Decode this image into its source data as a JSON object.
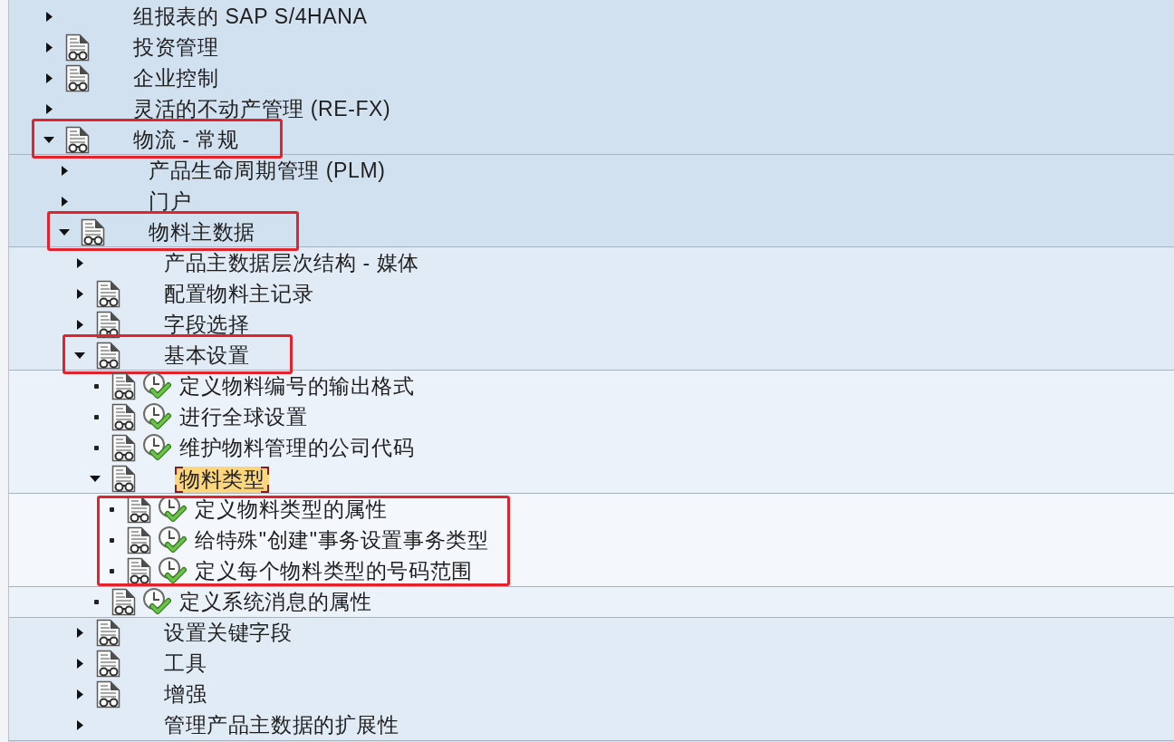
{
  "tree": [
    {
      "label": "组报表的 SAP S/4HANA",
      "kind": "folder",
      "expanded": false,
      "doc_icon": false,
      "selected": false,
      "marked": false
    },
    {
      "label": "投资管理",
      "kind": "folder",
      "expanded": false,
      "doc_icon": true,
      "selected": false,
      "marked": false
    },
    {
      "label": "企业控制",
      "kind": "folder",
      "expanded": false,
      "doc_icon": true,
      "selected": false,
      "marked": false
    },
    {
      "label": "灵活的不动产管理 (RE-FX)",
      "kind": "folder",
      "expanded": false,
      "doc_icon": false,
      "selected": false,
      "marked": false
    },
    {
      "label": "物流 - 常规",
      "kind": "folder",
      "expanded": true,
      "doc_icon": true,
      "selected": false,
      "marked": true,
      "children_marked": false,
      "children": [
        {
          "label": "产品生命周期管理 (PLM)",
          "kind": "folder",
          "expanded": false,
          "doc_icon": false,
          "selected": false,
          "marked": false
        },
        {
          "label": "门户",
          "kind": "folder",
          "expanded": false,
          "doc_icon": false,
          "selected": false,
          "marked": false
        },
        {
          "label": "物料主数据",
          "kind": "folder",
          "expanded": true,
          "doc_icon": true,
          "selected": false,
          "marked": true,
          "children_marked": false,
          "children": [
            {
              "label": "产品主数据层次结构 - 媒体",
              "kind": "folder",
              "expanded": false,
              "doc_icon": false,
              "selected": false,
              "marked": false
            },
            {
              "label": "配置物料主记录",
              "kind": "folder",
              "expanded": false,
              "doc_icon": true,
              "selected": false,
              "marked": false
            },
            {
              "label": "字段选择",
              "kind": "folder",
              "expanded": false,
              "doc_icon": true,
              "selected": false,
              "marked": false
            },
            {
              "label": "基本设置",
              "kind": "folder",
              "expanded": true,
              "doc_icon": true,
              "selected": false,
              "marked": true,
              "children_marked": false,
              "children": [
                {
                  "label": "定义物料编号的输出格式",
                  "kind": "activity",
                  "doc_icon": true,
                  "selected": false,
                  "marked": false
                },
                {
                  "label": "进行全球设置",
                  "kind": "activity",
                  "doc_icon": true,
                  "selected": false,
                  "marked": false
                },
                {
                  "label": "维护物料管理的公司代码",
                  "kind": "activity",
                  "doc_icon": true,
                  "selected": false,
                  "marked": false
                },
                {
                  "label": "物料类型",
                  "kind": "folder",
                  "expanded": true,
                  "doc_icon": true,
                  "selected": true,
                  "marked": false,
                  "children_marked": true,
                  "children": [
                    {
                      "label": "定义物料类型的属性",
                      "kind": "activity",
                      "doc_icon": true,
                      "selected": false,
                      "marked": false
                    },
                    {
                      "label": "给特殊\"创建\"事务设置事务类型",
                      "kind": "activity",
                      "doc_icon": true,
                      "selected": false,
                      "marked": false
                    },
                    {
                      "label": "定义每个物料类型的号码范围",
                      "kind": "activity",
                      "doc_icon": true,
                      "selected": false,
                      "marked": false
                    }
                  ]
                },
                {
                  "label": "定义系统消息的属性",
                  "kind": "activity",
                  "doc_icon": true,
                  "selected": false,
                  "marked": false
                }
              ]
            },
            {
              "label": "设置关键字段",
              "kind": "folder",
              "expanded": false,
              "doc_icon": true,
              "selected": false,
              "marked": false
            },
            {
              "label": "工具",
              "kind": "folder",
              "expanded": false,
              "doc_icon": true,
              "selected": false,
              "marked": false
            },
            {
              "label": "增强",
              "kind": "folder",
              "expanded": false,
              "doc_icon": true,
              "selected": false,
              "marked": false
            },
            {
              "label": "管理产品主数据的扩展性",
              "kind": "folder",
              "expanded": false,
              "doc_icon": false,
              "selected": false,
              "marked": false
            }
          ]
        }
      ]
    }
  ]
}
